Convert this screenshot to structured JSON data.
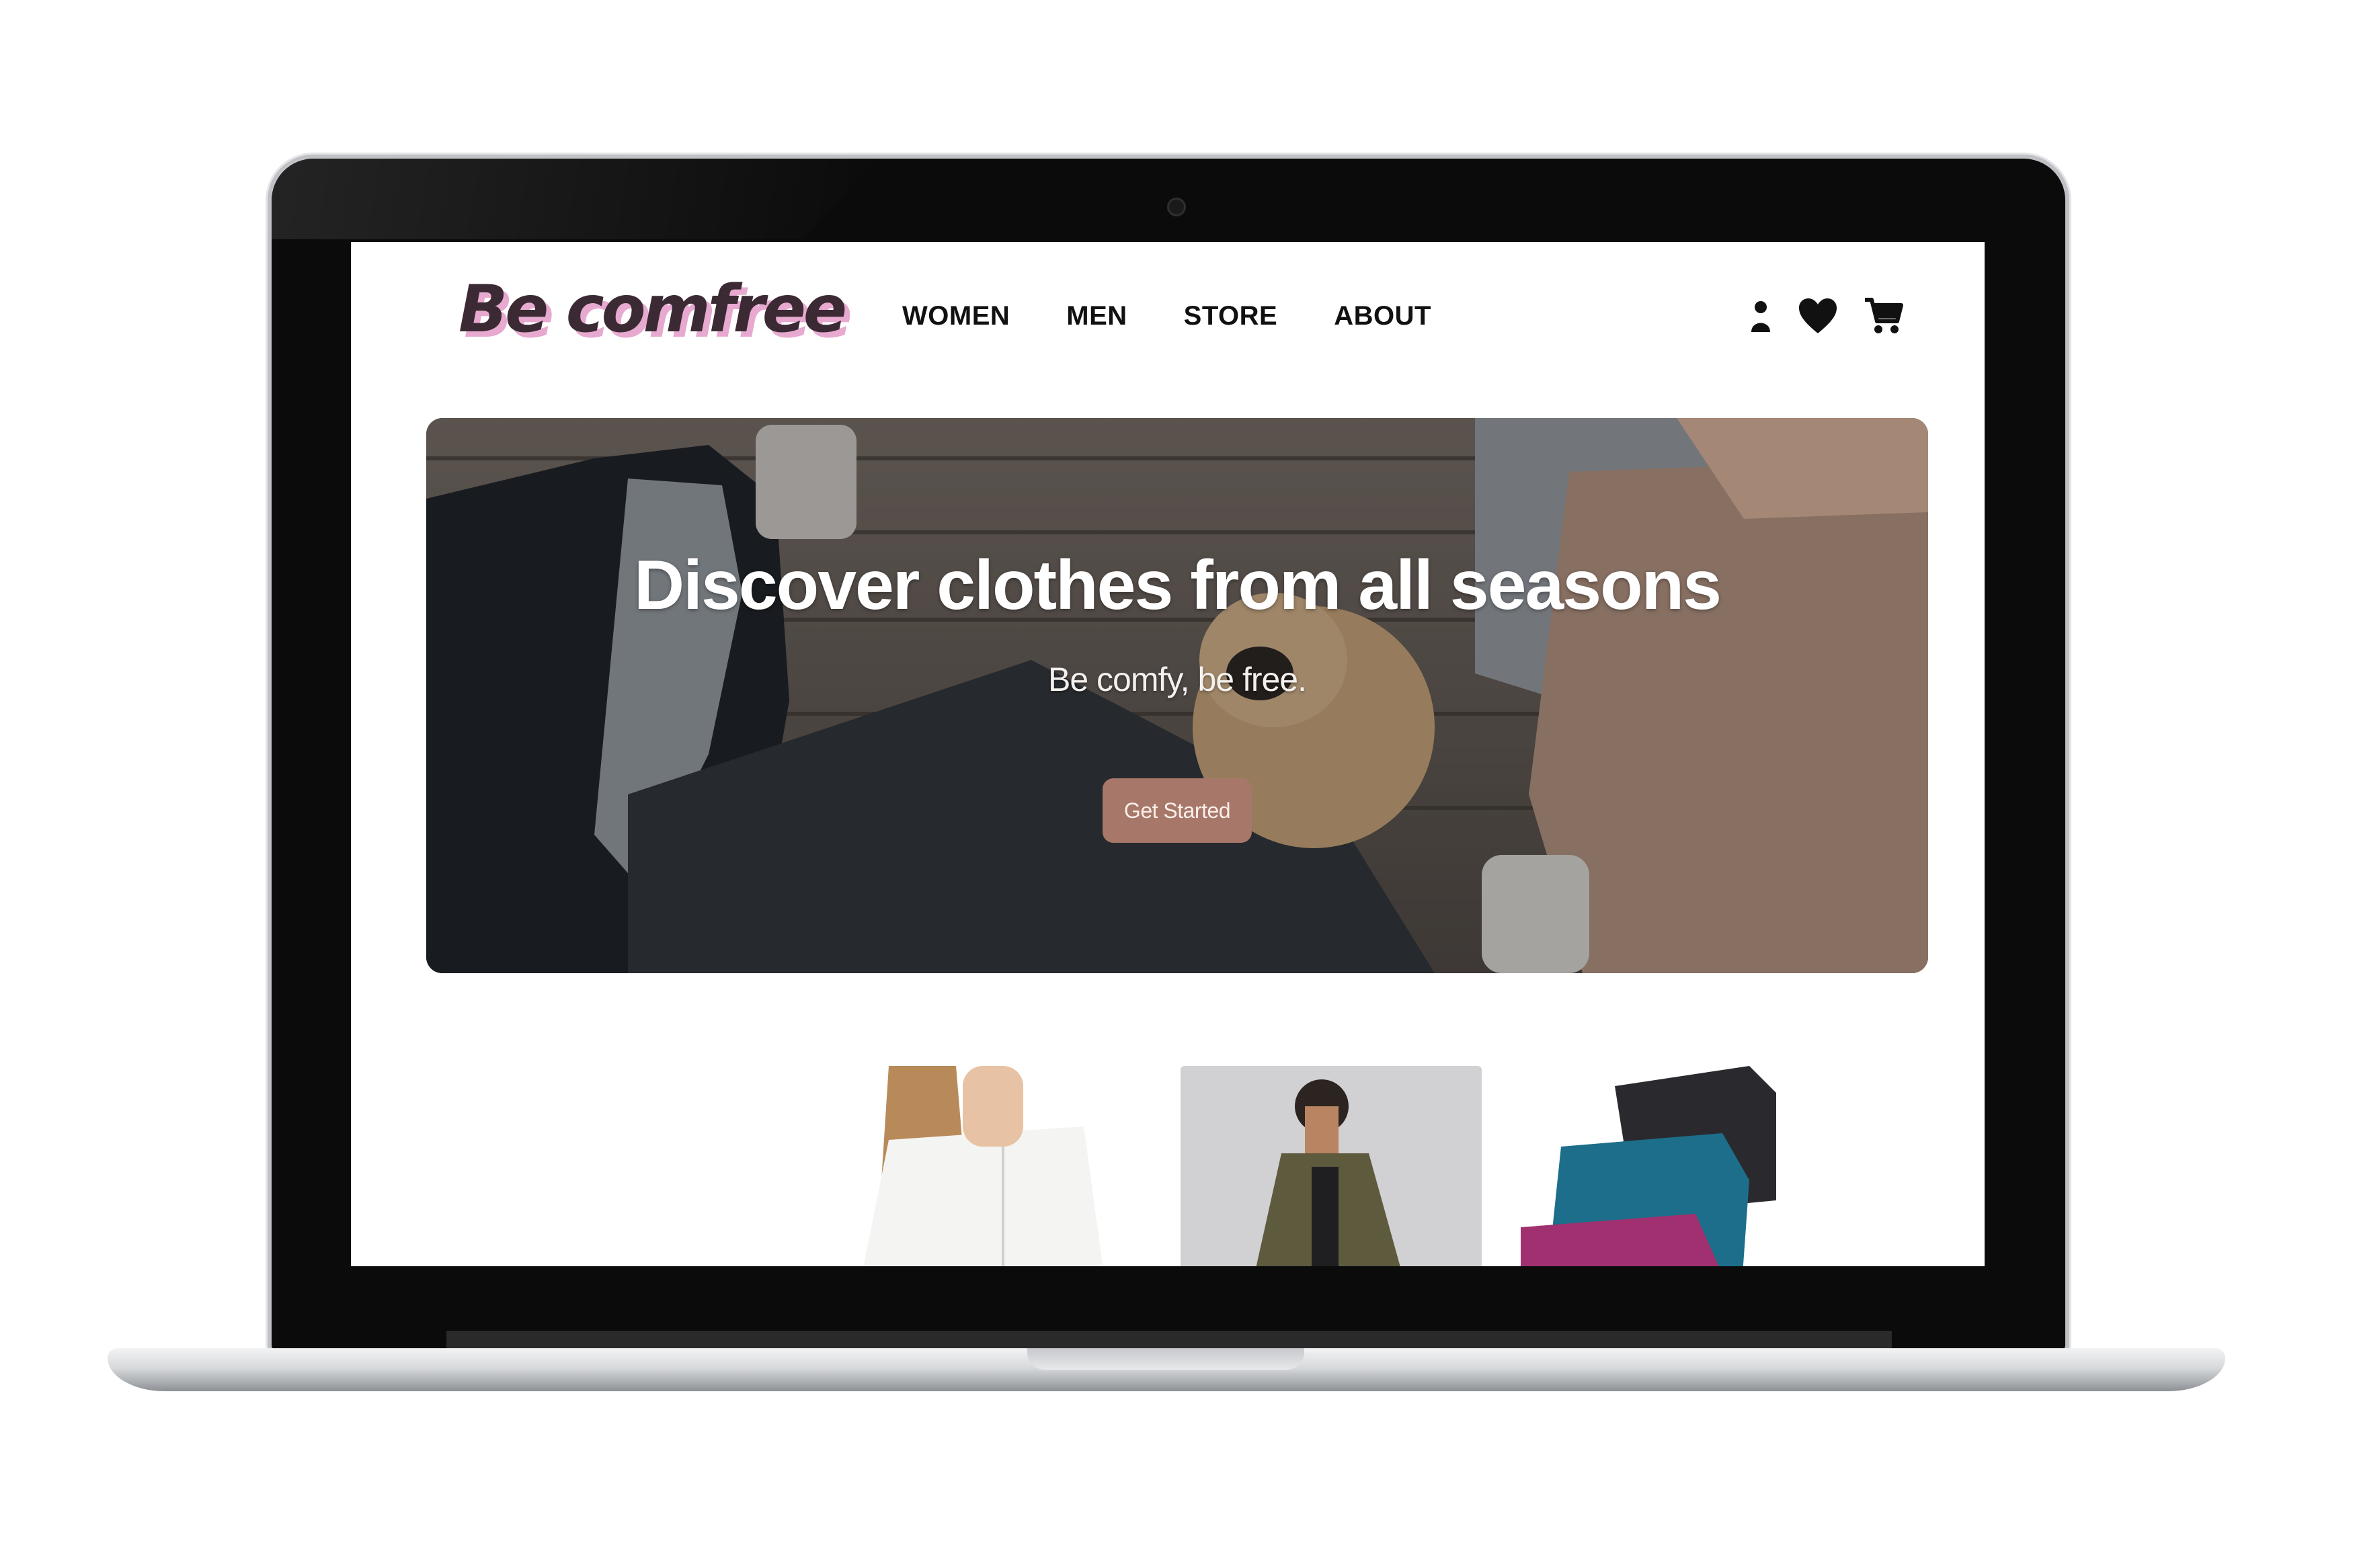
{
  "site": {
    "logo_text": "Be comfree",
    "nav": [
      "WOMEN",
      "MEN",
      "STORE",
      "ABOUT"
    ],
    "icons": [
      "user-icon",
      "heart-icon",
      "cart-icon"
    ]
  },
  "hero": {
    "title": "Discover clothes from all seasons",
    "subtitle": "Be comfy, be free.",
    "cta_label": "Get Started"
  },
  "products": [
    {
      "name": "white-blouse"
    },
    {
      "name": "olive-jacket"
    },
    {
      "name": "colored-tshirts"
    }
  ],
  "colors": {
    "logo_shadow": "#e7a9cf",
    "cta_background": "#a7776a"
  }
}
